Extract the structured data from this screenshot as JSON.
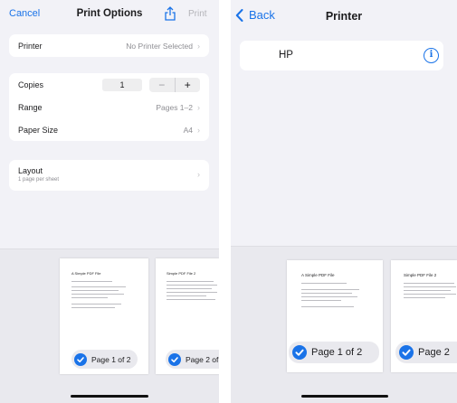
{
  "left": {
    "nav": {
      "cancel": "Cancel",
      "title": "Print Options",
      "share_icon": "share-icon",
      "print": "Print"
    },
    "printer": {
      "label": "Printer",
      "value": "No Printer Selected"
    },
    "copies": {
      "label": "Copies",
      "count": "1",
      "minus": "−",
      "plus": "+"
    },
    "range": {
      "label": "Range",
      "value": "Pages 1–2"
    },
    "paper_size": {
      "label": "Paper Size",
      "value": "A4"
    },
    "layout": {
      "label": "Layout",
      "sublabel": "1 page per sheet"
    },
    "preview": {
      "pages": [
        {
          "title": "A Simple PDF File",
          "badge": "Page 1 of 2"
        },
        {
          "title": "Simple PDF File 2",
          "badge": "Page 2 of"
        }
      ]
    },
    "colors": {
      "accent": "#1a73e8",
      "background": "#f2f2f7"
    }
  },
  "right": {
    "nav": {
      "back": "Back",
      "title": "Printer"
    },
    "printer": {
      "name": "HP",
      "info_icon": "info-icon"
    },
    "preview": {
      "pages": [
        {
          "title": "A Simple PDF File",
          "badge": "Page 1 of 2"
        },
        {
          "title": "Simple PDF File 2",
          "badge": "Page 2"
        }
      ]
    }
  }
}
